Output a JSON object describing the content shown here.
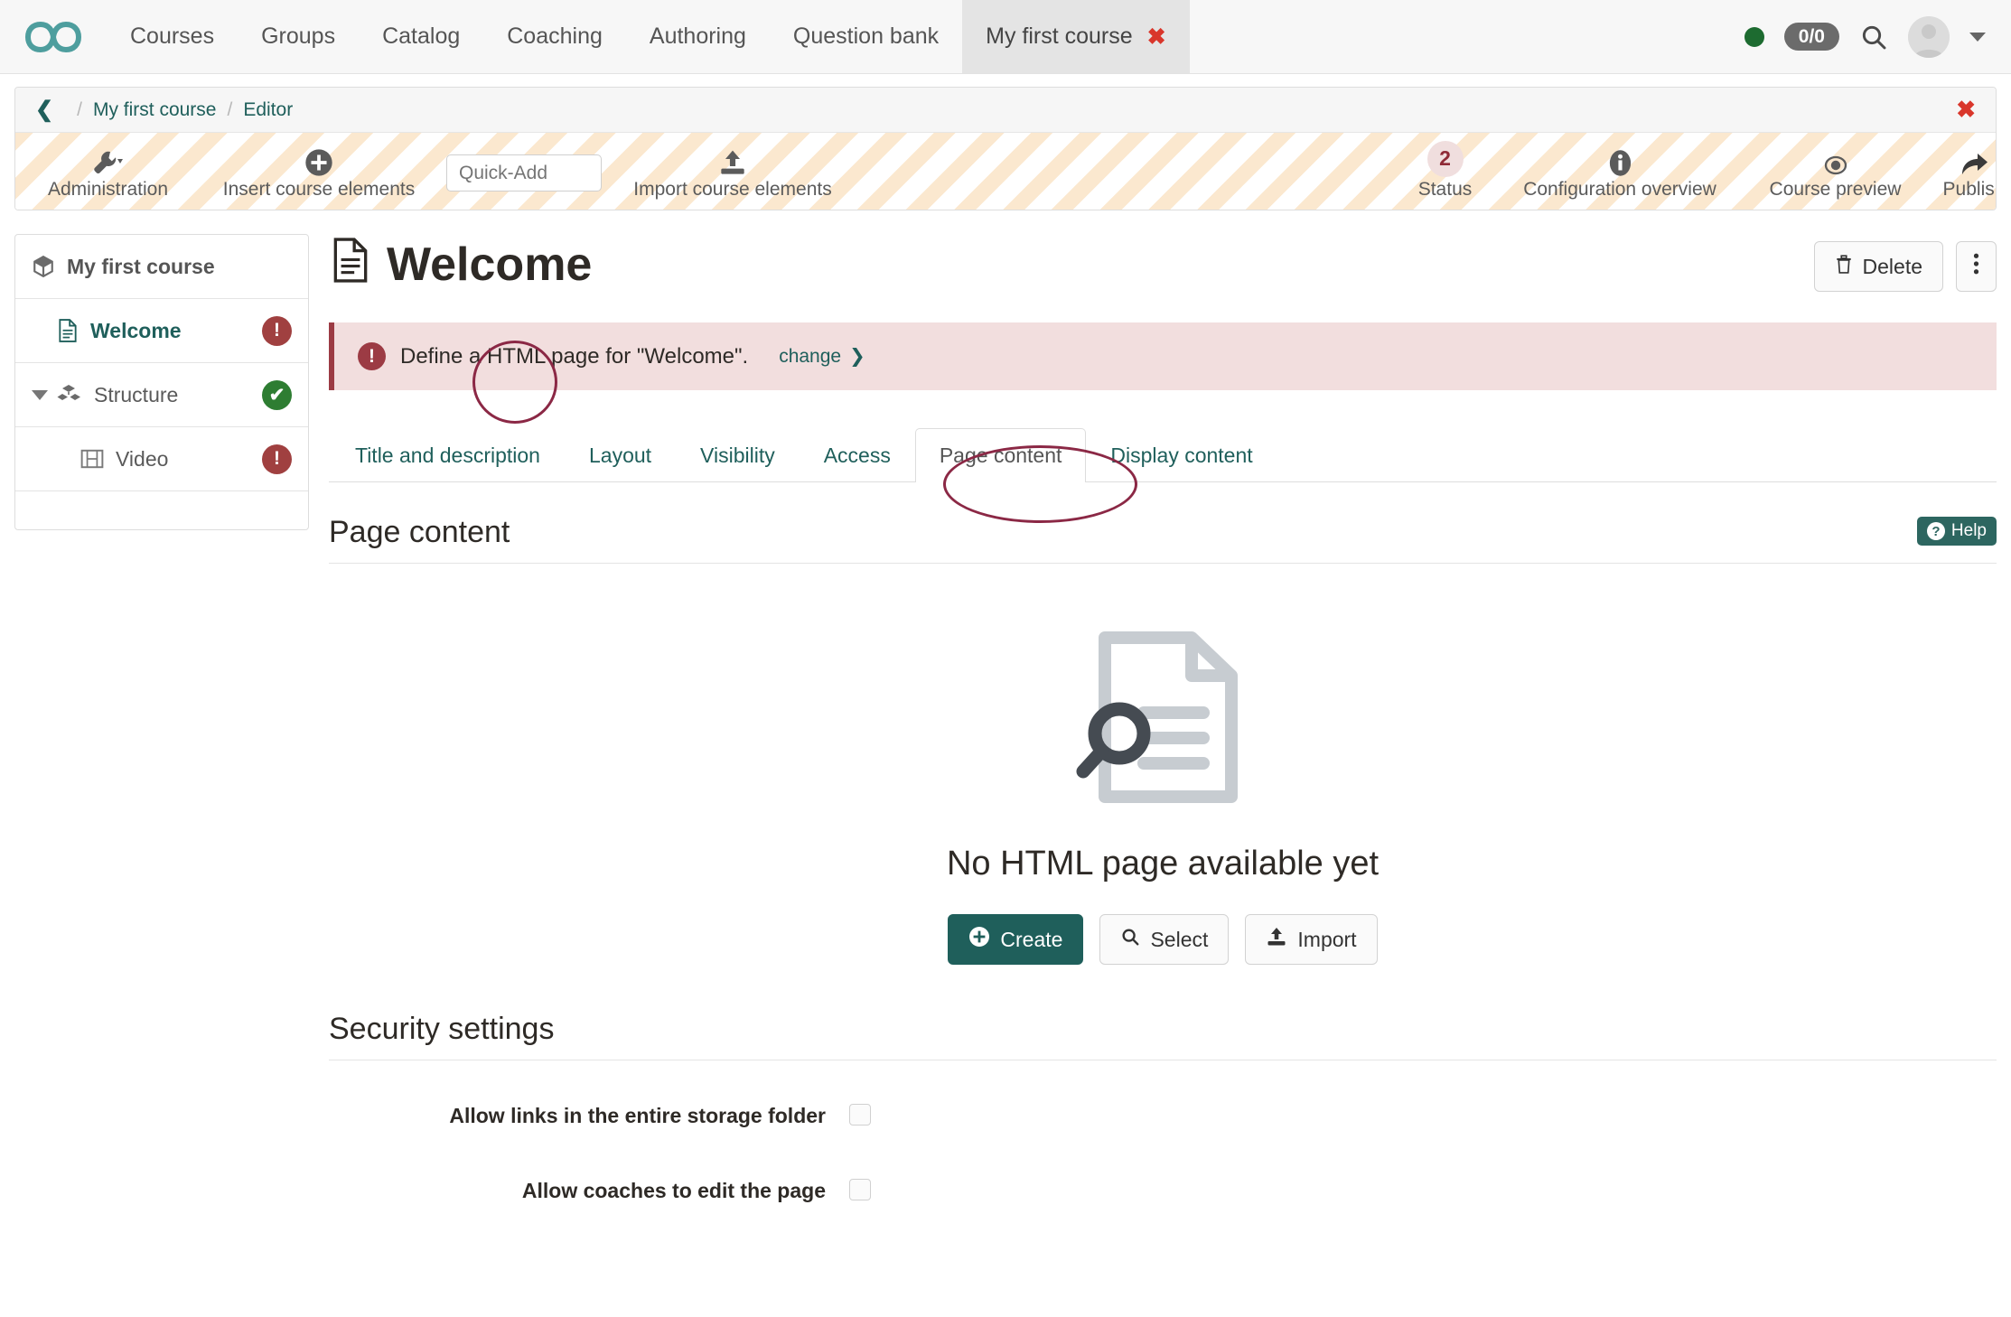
{
  "topnav": {
    "logo_icon": "infinity-logo-icon",
    "items": [
      {
        "label": "Courses",
        "active": false
      },
      {
        "label": "Groups",
        "active": false
      },
      {
        "label": "Catalog",
        "active": false
      },
      {
        "label": "Coaching",
        "active": false
      },
      {
        "label": "Authoring",
        "active": false
      },
      {
        "label": "Question bank",
        "active": false
      },
      {
        "label": "My first course",
        "active": true,
        "closable": true
      }
    ],
    "status_indicator": "online",
    "counter_badge": "0/0",
    "search_icon": "search-icon",
    "avatar_icon": "avatar-icon",
    "user_menu_caret": "chevron-down-icon"
  },
  "breadcrumb": {
    "back_icon": "chevron-left-icon",
    "separator": "/",
    "items": [
      "My first course",
      "Editor"
    ],
    "close_icon": "close-icon"
  },
  "toolbar": {
    "items": [
      {
        "label": "Administration",
        "icon": "wrench-icon",
        "has_caret": true
      },
      {
        "label": "Insert course elements",
        "icon": "plus-circle-icon"
      },
      {
        "label": "Import course elements",
        "icon": "upload-icon"
      },
      {
        "label": "Status",
        "icon": "status-count",
        "count": "2"
      },
      {
        "label": "Configuration overview",
        "icon": "info-icon"
      },
      {
        "label": "Course preview",
        "icon": "eye-icon"
      },
      {
        "label": "Publish",
        "icon": "share-arrow-icon"
      }
    ],
    "quick_add_placeholder": "Quick-Add",
    "quick_add_value": ""
  },
  "sidebar": {
    "root": {
      "label": "My first course",
      "icon": "course-box-icon"
    },
    "nodes": [
      {
        "label": "Welcome",
        "icon": "page-icon",
        "selected": true,
        "status": "warn",
        "status_glyph": "!",
        "indent": 1
      },
      {
        "label": "Structure",
        "icon": "structure-icon",
        "selected": false,
        "status": "ok",
        "status_glyph": "✔",
        "indent": 1,
        "expanded": true
      },
      {
        "label": "Video",
        "icon": "video-icon",
        "selected": false,
        "status": "warn",
        "status_glyph": "!",
        "indent": 2
      }
    ]
  },
  "page": {
    "title": "Welcome",
    "title_icon": "page-icon",
    "delete_label": "Delete",
    "delete_icon": "trash-icon",
    "more_icon": "more-vertical-icon"
  },
  "alert": {
    "icon": "exclamation-circle-icon",
    "message": "Define a HTML page for \"Welcome\".",
    "link_label": "change",
    "link_icon": "chevron-right-icon"
  },
  "tabs": [
    {
      "label": "Title and description",
      "active": false
    },
    {
      "label": "Layout",
      "active": false
    },
    {
      "label": "Visibility",
      "active": false
    },
    {
      "label": "Access",
      "active": false
    },
    {
      "label": "Page content",
      "active": true
    },
    {
      "label": "Display content",
      "active": false
    }
  ],
  "page_content_section": {
    "heading": "Page content",
    "help_label": "Help",
    "help_icon": "question-circle-icon",
    "empty_icon": "document-search-icon",
    "empty_title": "No HTML page available yet",
    "buttons": [
      {
        "label": "Create",
        "icon": "plus-circle-icon",
        "primary": true
      },
      {
        "label": "Select",
        "icon": "search-icon",
        "primary": false
      },
      {
        "label": "Import",
        "icon": "upload-icon",
        "primary": false
      }
    ]
  },
  "security_section": {
    "heading": "Security settings",
    "rows": [
      {
        "label": "Allow links in the entire storage folder",
        "checked": false
      },
      {
        "label": "Allow coaches to edit the page",
        "checked": false
      }
    ]
  },
  "annotations": [
    {
      "name": "html-word-circle"
    },
    {
      "name": "page-content-tab-circle"
    }
  ],
  "colors": {
    "brand_teal": "#1f5f5b",
    "logo_teal": "#4e9e9e",
    "alert_red": "#9c3b44",
    "annotation_maroon": "#8b2845",
    "stripe_orange": "#fbe8cf",
    "status_green": "#2e7d32"
  }
}
